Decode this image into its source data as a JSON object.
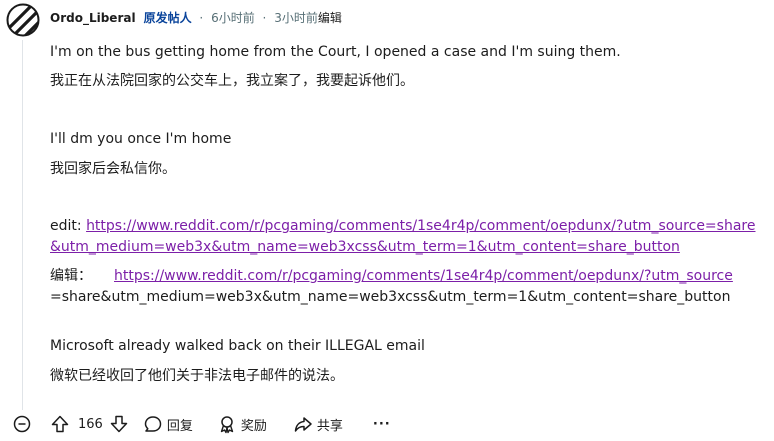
{
  "comment": {
    "username": "Ordo_Liberal",
    "op_badge": "原发帖人",
    "separator": "·",
    "posted": "6小时前",
    "edited_time": "3小时前",
    "edited_label": "编辑",
    "paragraphs": [
      "I'm on the bus getting home from the Court, I opened a case and I'm suing them.",
      "我正在从法院回家的公交车上，我立案了，我要起诉他们。",
      "I'll dm you once I'm home",
      "我回家后会私信你。"
    ],
    "edit_prefix": "edit:",
    "edit_url": "https://www.reddit.com/r/pcgaming/comments/1se4r4p/comment/oepdunx/?utm_source=share&utm_medium=web3x&utm_name=web3xcss&utm_term=1&utm_content=share_button",
    "cn_edit_prefix": "编辑：",
    "cn_edit_url_part": "https://www.reddit.com/r/pcgaming/comments/1se4r4p/comment/oepdunx/?utm_source",
    "cn_edit_url_rest": "=share&utm_medium=web3x&utm_name=web3xcss&utm_term=1&utm_content=share_button",
    "closing_en": "Microsoft already walked back on their ILLEGAL email",
    "closing_cn": "微软已经收回了他们关于非法电子邮件的说法。"
  },
  "actions": {
    "score": "166",
    "reply": "回复",
    "award": "奖励",
    "share": "共享",
    "more": "···"
  }
}
